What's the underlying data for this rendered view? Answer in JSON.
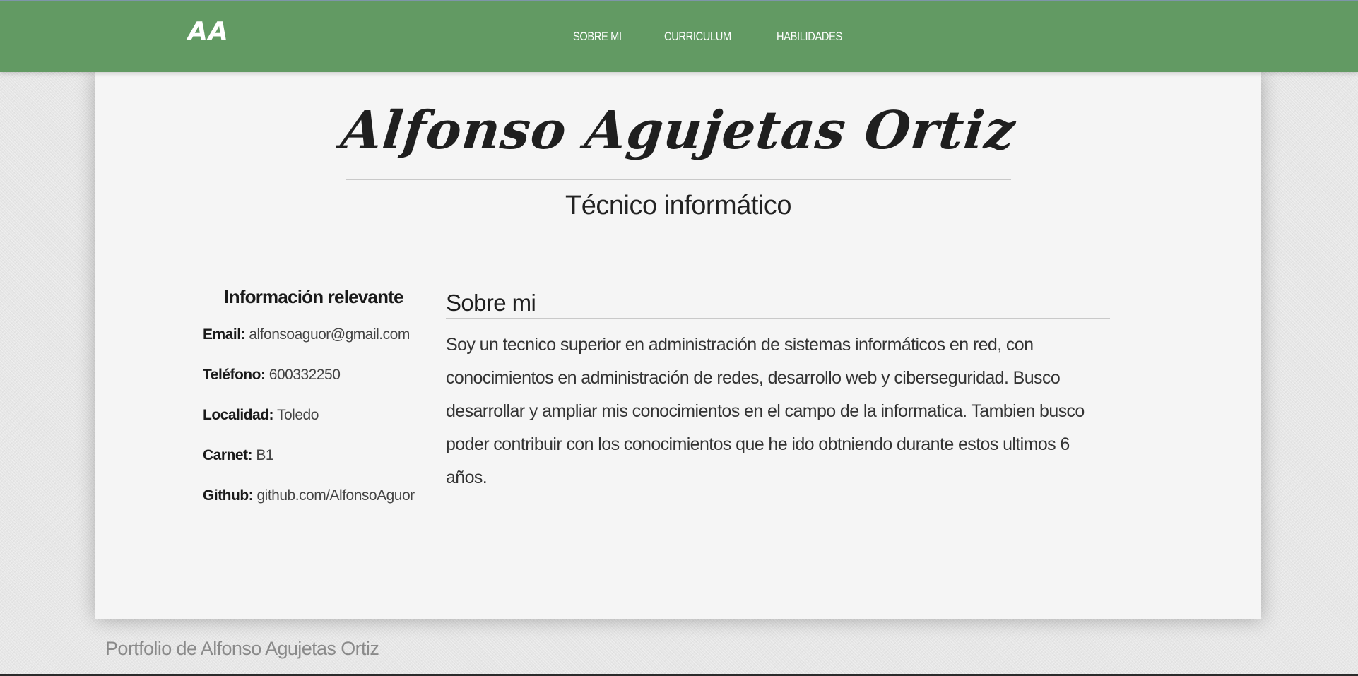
{
  "header": {
    "logo": "AA",
    "nav": [
      {
        "label": "SOBRE MI"
      },
      {
        "label": "CURRICULUM"
      },
      {
        "label": "HABILIDADES"
      }
    ]
  },
  "hero": {
    "name": "Alfonso Agujetas Ortiz",
    "subtitle": "Técnico informático"
  },
  "info": {
    "heading": "Información relevante",
    "items": [
      {
        "label": "Email:",
        "value": "alfonsoaguor@gmail.com"
      },
      {
        "label": "Teléfono:",
        "value": "600332250"
      },
      {
        "label": "Localidad:",
        "value": "Toledo"
      },
      {
        "label": "Carnet:",
        "value": "B1"
      },
      {
        "label": "Github:",
        "value": "github.com/AlfonsoAguor"
      }
    ]
  },
  "about": {
    "heading": "Sobre mi",
    "text": "Soy un tecnico superior en administración de sistemas informáticos en red, con conocimientos en administración de redes, desarrollo web y ciberseguridad. Busco desarrollar y ampliar mis conocimientos en el campo de la informatica. Tambien busco poder contribuir con los conocimientos que he ido obtniendo durante estos ultimos 6 años."
  },
  "footer": {
    "text": "Portfolio de Alfonso Agujetas Ortiz"
  },
  "colors": {
    "navbar": "#629a63",
    "card": "#f5f5f5",
    "page_bg": "#e6e6e6",
    "text": "#1f1f1f"
  }
}
